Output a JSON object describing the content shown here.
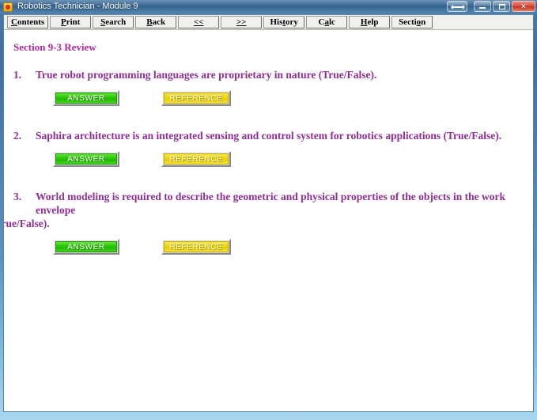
{
  "window": {
    "title": "Robotics Technician - Module 9",
    "icon": "app-icon",
    "controls": {
      "help_pin": "",
      "minimize": "",
      "maximize": "",
      "close": "✕"
    },
    "frame_color": "#4a7ba8",
    "titlebar_color": "#2f5e8d",
    "close_color": "#c0341f"
  },
  "toolbar": {
    "buttons": [
      {
        "label": "Contents",
        "accesskey": "C"
      },
      {
        "label": "Print",
        "accesskey": "P"
      },
      {
        "label": "Search",
        "accesskey": "S"
      },
      {
        "label": "Back",
        "accesskey": "B"
      },
      {
        "label": "<<",
        "accesskey": "<"
      },
      {
        "label": ">>",
        "accesskey": ">"
      },
      {
        "label": "History",
        "accesskey": "t"
      },
      {
        "label": "Calc",
        "accesskey": "a"
      },
      {
        "label": "Help",
        "accesskey": "H"
      },
      {
        "label": "Section",
        "accesskey": "o"
      }
    ]
  },
  "document": {
    "heading": "Section 9-3 Review",
    "heading_color": "#b4289b",
    "text_color": "#8f2f96",
    "answer_label": "ANSWER",
    "reference_label": "REFERENCE",
    "answer_color": "#2fcc08",
    "reference_color": "#efd711",
    "questions": [
      {
        "number": "1.",
        "text": "True robot programming languages are proprietary in nature (True/False).",
        "text_line2": "",
        "answer_label": "ANSWER",
        "reference_label": "REFERENCE"
      },
      {
        "number": "2.",
        "text": "Saphira architecture is an integrated sensing and control system for robotics applications (True/False).",
        "text_line2": "",
        "answer_label": "ANSWER",
        "reference_label": "REFERENCE"
      },
      {
        "number": "3.",
        "text": "World modeling is required to describe the geometric and physical properties of the objects in the work envelope",
        "text_line2": "(True/False).",
        "answer_label": "ANSWER",
        "reference_label": "REFERENCE"
      }
    ]
  }
}
